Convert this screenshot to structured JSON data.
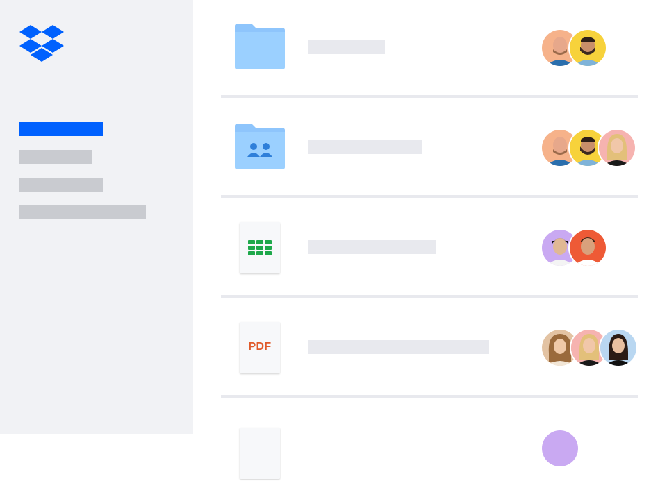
{
  "colors": {
    "brand_blue": "#0061fe",
    "sidebar_bg": "#f1f2f5",
    "placeholder_gray": "#c9cbd0",
    "row_placeholder": "#e8e9ee",
    "folder_blue": "#8ec5fc",
    "spreadsheet_green": "#1ea84a",
    "pdf_orange": "#e05a2b"
  },
  "sidebar": {
    "logo_icon": "dropbox-logo-icon",
    "nav_items": [
      {
        "name": "nav-item-active",
        "state": "active"
      },
      {
        "name": "nav-item-2",
        "state": "inactive"
      },
      {
        "name": "nav-item-3",
        "state": "inactive"
      },
      {
        "name": "nav-item-4",
        "state": "inactive"
      }
    ]
  },
  "files": [
    {
      "icon": "folder-icon",
      "type": "folder",
      "collaborators": [
        "avatar-man-beard-orange-bg",
        "avatar-man-beard-yellow-bg"
      ]
    },
    {
      "icon": "shared-folder-icon",
      "type": "shared-folder",
      "collaborators": [
        "avatar-man-beard-orange-bg",
        "avatar-man-beard-yellow-bg",
        "avatar-woman-blonde-pink-bg"
      ]
    },
    {
      "icon": "spreadsheet-icon",
      "type": "spreadsheet",
      "collaborators": [
        "avatar-man-purple-bg",
        "avatar-man-red-bg"
      ]
    },
    {
      "icon": "pdf-icon",
      "type": "pdf",
      "label": "PDF",
      "collaborators": [
        "avatar-woman-curly-tan-bg",
        "avatar-woman-blonde-pink-bg",
        "avatar-woman-dark-hair-blue-bg"
      ]
    },
    {
      "icon": "document-icon",
      "type": "document",
      "collaborators": [
        "avatar-purple-bg"
      ]
    }
  ]
}
